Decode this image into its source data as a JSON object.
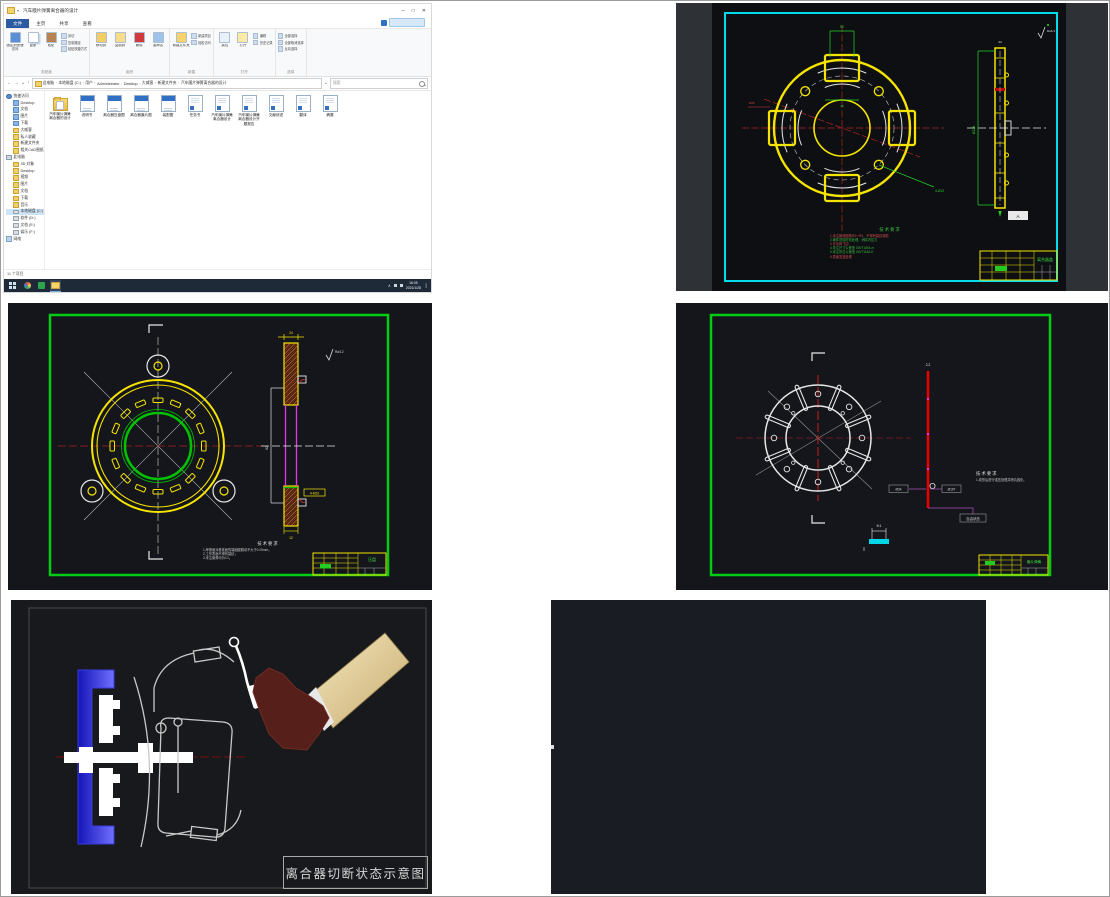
{
  "explorer": {
    "title": "汽车膜片弹簧离合器的设计",
    "window_controls": {
      "min": "─",
      "max": "□",
      "close": "✕"
    },
    "tabs": {
      "file": "文件",
      "items": [
        "主页",
        "共享",
        "查看"
      ]
    },
    "ribbon": {
      "clipboard": {
        "label": "剪贴板",
        "big": [
          {
            "label": "固定到快速访问",
            "ic": "pin"
          },
          {
            "label": "复制",
            "ic": "copy"
          },
          {
            "label": "粘贴",
            "ic": "paste"
          }
        ],
        "small": [
          "剪切",
          "复制路径",
          "粘贴快捷方式"
        ]
      },
      "organize": {
        "label": "组织",
        "big": [
          {
            "label": "移动到",
            "ic": "move"
          },
          {
            "label": "复制到",
            "ic": "copyto"
          },
          {
            "label": "删除",
            "ic": "del"
          },
          {
            "label": "重命名",
            "ic": "ren"
          }
        ],
        "small": []
      },
      "new": {
        "label": "新建",
        "big": [
          {
            "label": "新建文件夹",
            "ic": "newf"
          }
        ],
        "small": [
          "新建项目",
          "轻松访问"
        ]
      },
      "open": {
        "label": "打开",
        "big": [
          {
            "label": "属性",
            "ic": "prop"
          },
          {
            "label": "打开",
            "ic": "open"
          }
        ],
        "small": [
          "编辑",
          "历史记录"
        ]
      },
      "select": {
        "label": "选择",
        "big": [],
        "small": [
          "全部选择",
          "全部取消选择",
          "反向选择"
        ]
      }
    },
    "nav": {
      "crumbs": [
        "此电脑",
        "本地磁盘 (C:)",
        "用户",
        "Administrator",
        "Desktop",
        "大威客",
        "新建文件夹",
        "汽车膜片弹簧离合器的设计"
      ],
      "search": "搜索"
    },
    "sidebar": {
      "items": [
        {
          "t": "快速访问",
          "c": "s-star lv0"
        },
        {
          "t": "Desktop",
          "c": "s-pin lv1"
        },
        {
          "t": "文档",
          "c": "s-pin lv1"
        },
        {
          "t": "图片",
          "c": "s-pin lv1"
        },
        {
          "t": "下载",
          "c": "s-pin lv1"
        },
        {
          "t": "大威客",
          "c": "s-fold lv1"
        },
        {
          "t": "私人收藏",
          "c": "s-fold lv1"
        },
        {
          "t": "新建文件夹",
          "c": "s-fold lv1"
        },
        {
          "t": "相关CAD图纸",
          "c": "s-fold lv1"
        },
        {
          "t": "此电脑",
          "c": "s-pc lv0"
        },
        {
          "t": "3D 对象",
          "c": "s-fold lv1"
        },
        {
          "t": "Desktop",
          "c": "s-fold lv1"
        },
        {
          "t": "视频",
          "c": "s-fold lv1"
        },
        {
          "t": "图片",
          "c": "s-fold lv1"
        },
        {
          "t": "文档",
          "c": "s-fold lv1"
        },
        {
          "t": "下载",
          "c": "s-fold lv1"
        },
        {
          "t": "音乐",
          "c": "s-fold lv1"
        },
        {
          "t": "本地磁盘 (C:)",
          "c": "s-disk lv1 sel"
        },
        {
          "t": "软件 (D:)",
          "c": "s-disk lv1"
        },
        {
          "t": "文档 (E:)",
          "c": "s-disk lv1"
        },
        {
          "t": "娱乐 (F:)",
          "c": "s-disk lv1"
        },
        {
          "t": "网络",
          "c": "s-net lv0"
        }
      ]
    },
    "files": [
      {
        "name": "汽车膜片弹簧离合器的设计",
        "type": "folder"
      },
      {
        "name": "说明书",
        "type": "dwg"
      },
      {
        "name": "离合器压盘图",
        "type": "dwg"
      },
      {
        "name": "离合器膜片图",
        "type": "dwg"
      },
      {
        "name": "装配图",
        "type": "dwg"
      },
      {
        "name": "任务书",
        "type": "doc"
      },
      {
        "name": "汽车膜片弹簧离合器设计",
        "type": "doc"
      },
      {
        "name": "汽车膜片弹簧离合器设计开题报告",
        "type": "doc"
      },
      {
        "name": "文献综述",
        "type": "doc"
      },
      {
        "name": "翻译",
        "type": "doc"
      },
      {
        "name": "摘要",
        "type": "doc"
      }
    ],
    "status": "11 个项目",
    "taskbar": {
      "time": "16:05",
      "date": "2021/1/28"
    }
  },
  "cad1": {
    "notes_title": "技术要求",
    "notes": [
      {
        "t": "1.未注铸造圆角R3～R5，不得有裂纹缺陷",
        "c": "red"
      },
      {
        "t": "2.铸件须经时效处理，消除内应力",
        "c": "green"
      },
      {
        "t": "3.去毛刺飞边",
        "c": "red"
      },
      {
        "t": "4.未注尺寸公差按 GB/T1804-m",
        "c": "green"
      },
      {
        "t": "5.未注形位公差按 GB/T1184-K",
        "c": "green"
      },
      {
        "t": "6.表面发蓝处理",
        "c": "red"
      }
    ],
    "dims": {
      "top": "50",
      "window": "40",
      "leader": "4-Ø12",
      "side": "Ø228",
      "side_top": "24",
      "tag": "A",
      "surface": "Ra6.3",
      "left": "Ø25"
    },
    "part_name": "离合器盖"
  },
  "cad2": {
    "notes_title": "技术要求",
    "notes": [
      {
        "t": "1.摩擦面对基准面的端面圆跳动不大于0.05mm；",
        "c": "white"
      },
      {
        "t": "2.工作表面不得有裂纹；",
        "c": "white"
      },
      {
        "t": "3.未注倒角均为C1。",
        "c": "white"
      }
    ],
    "dims": {
      "top": "24",
      "left": "52",
      "box": "4-M10",
      "bottom": "12",
      "surface": "Ra3.2"
    },
    "part_name": "压盘"
  },
  "cad3": {
    "notes_title": "技术要求",
    "notes": [
      {
        "t": "1.成形后进行强压处理并喷丸强化。",
        "c": "white"
      }
    ],
    "dims": {
      "thickness": "2.2",
      "left_box": "Ø34",
      "right_box": "Ø197",
      "bottom_box": "自由状态",
      "detail": "5:1"
    },
    "part_name": "膜片弹簧"
  },
  "clutch": {
    "caption": "离合器切断状态示意图"
  }
}
